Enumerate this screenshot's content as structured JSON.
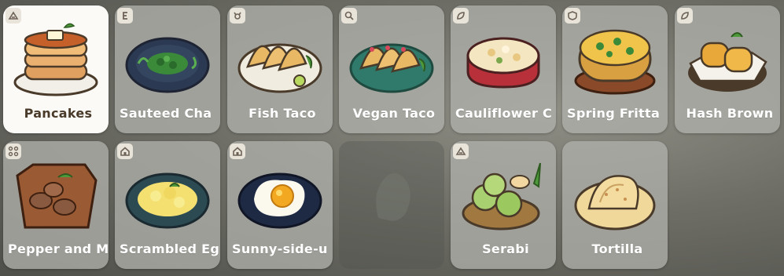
{
  "recipes": [
    {
      "label": "Pancakes",
      "icon": "farm-icon",
      "selected": true
    },
    {
      "label": "Sauteed Cha",
      "icon": "e-badge-icon"
    },
    {
      "label": "Fish Taco",
      "icon": "crab-icon"
    },
    {
      "label": "Vegan Taco",
      "icon": "no-meat-icon"
    },
    {
      "label": "Cauliflower C",
      "icon": "leaf-icon"
    },
    {
      "label": "Spring Fritta",
      "icon": "shield-icon"
    },
    {
      "label": "Hash Brown",
      "icon": "leaf-icon"
    },
    {
      "label": "Pepper and M",
      "icon": "network-icon"
    },
    {
      "label": "Scrambled Eg",
      "icon": "house-icon"
    },
    {
      "label": "Sunny-side-u",
      "icon": "house-icon"
    },
    {
      "label": "",
      "icon": "",
      "empty": true
    },
    {
      "label": "Serabi",
      "icon": "farm-icon"
    },
    {
      "label": "Tortilla",
      "icon": ""
    }
  ],
  "colors": {
    "card": "#b0b0aa",
    "selected_card": "#fbfaf6",
    "label": "#ffffff",
    "selected_label": "#4a3a2a"
  }
}
